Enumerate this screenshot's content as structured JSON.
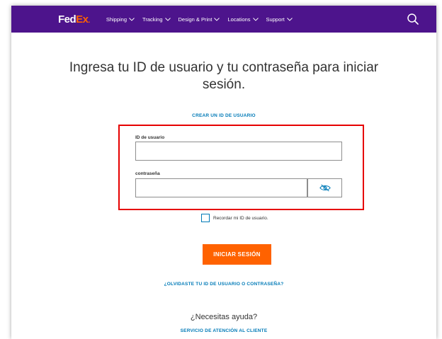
{
  "brand": {
    "logo_fed": "Fed",
    "logo_ex": "Ex",
    "logo_dot": ".",
    "primary_color": "#4d148c",
    "accent_color": "#ff6200",
    "link_color": "#007ab7"
  },
  "nav": {
    "items": [
      {
        "label": "Shipping",
        "icon": "chevron-down-icon"
      },
      {
        "label": "Tracking",
        "icon": "chevron-down-icon"
      },
      {
        "label": "Design & Print",
        "icon": "chevron-down-icon"
      },
      {
        "label": "Locations",
        "icon": "chevron-down-icon"
      },
      {
        "label": "Support",
        "icon": "chevron-down-icon"
      }
    ],
    "search_icon": "search-icon"
  },
  "login": {
    "heading": "Ingresa tu ID de usuario y tu contraseña para iniciar sesión.",
    "create_user_link": "CREAR UN ID DE USUARIO",
    "user_id_label": "ID de usuario",
    "user_id_value": "",
    "password_label": "contraseña",
    "password_value": "",
    "password_toggle_icon": "eye-slash-icon",
    "remember_label": "Recordar mi ID de usuario.",
    "remember_checked": false,
    "submit_label": "INICIAR SESIÓN",
    "forgot_link": "¿OLVIDASTE TU ID DE USUARIO O CONTRASEÑA?",
    "help_text": "¿Necesitas ayuda?",
    "service_link": "SERVICIO DE ATENCIÓN AL CLIENTE"
  },
  "annotation": {
    "highlight_color": "#e60000"
  }
}
